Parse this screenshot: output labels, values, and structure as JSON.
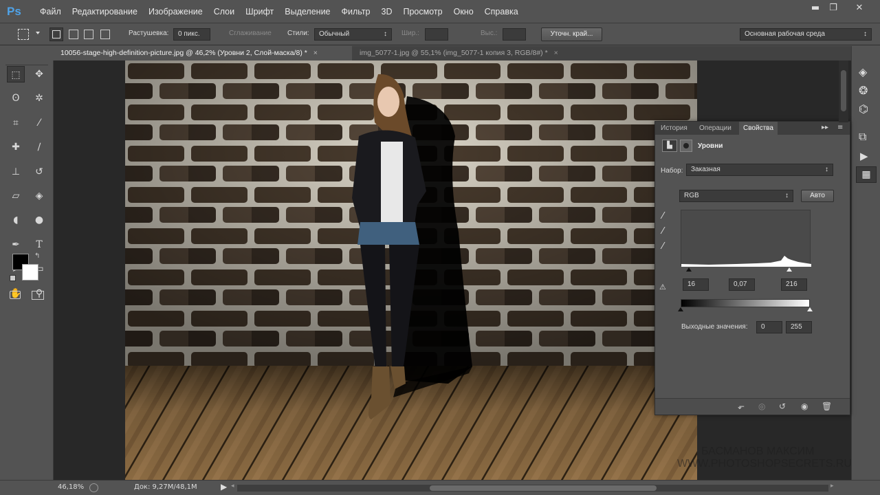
{
  "app": {
    "logo": "Ps"
  },
  "menu": [
    "Файл",
    "Редактирование",
    "Изображение",
    "Слои",
    "Шрифт",
    "Выделение",
    "Фильтр",
    "3D",
    "Просмотр",
    "Окно",
    "Справка"
  ],
  "window_controls": {
    "minimize": "▬",
    "restore": "❐",
    "close": "✕"
  },
  "options": {
    "feather_label": "Растушевка:",
    "feather_value": "0 пикс.",
    "antialias_label": "Сглаживание",
    "style_label": "Стили:",
    "style_value": "Обычный",
    "width_label": "Шир.:",
    "height_label": "Выс.:",
    "refine_button": "Уточн. край...",
    "workspace": "Основная рабочая среда"
  },
  "tabs": [
    {
      "label": "10056-stage-high-definition-picture.jpg @ 46,2% (Уровни 2, Слой-маска/8) *",
      "active": true
    },
    {
      "label": "img_5077-1.jpg @ 55,1% (img_5077-1 копия 3, RGB/8#) *",
      "active": false
    }
  ],
  "tab_close": "×",
  "panel": {
    "tabs": [
      "История",
      "Операции",
      "Свойства"
    ],
    "active_tab": "Свойства",
    "title": "Уровни",
    "preset_label": "Набор:",
    "preset_value": "Заказная",
    "channel": "RGB",
    "auto_button": "Авто",
    "input_black": "16",
    "input_gamma": "0,07",
    "input_white": "216",
    "output_label": "Выходные значения:",
    "output_black": "0",
    "output_white": "255"
  },
  "status": {
    "zoom": "46,18%",
    "doc": "Док: 9,27M/48,1M"
  },
  "watermark": {
    "line1": "БАСМАНОВ МАКСИМ",
    "line2": "WWW.PHOTOSHOPSECRETS.RU"
  },
  "icons": {
    "tools": [
      "marquee-icon",
      "move-icon",
      "lasso-icon",
      "magic-wand-icon",
      "crop-icon",
      "eyedropper-icon",
      "healing-brush-icon",
      "brush-icon",
      "clone-stamp-icon",
      "history-brush-icon",
      "eraser-icon",
      "paint-bucket-icon",
      "blur-icon",
      "dodge-icon",
      "pen-icon",
      "type-icon",
      "path-selection-icon",
      "rectangle-icon",
      "hand-icon",
      "zoom-icon"
    ]
  },
  "colors": {
    "accent": "#4fa3e8",
    "ui_bg": "#535353",
    "canvas_bg": "#282828"
  }
}
